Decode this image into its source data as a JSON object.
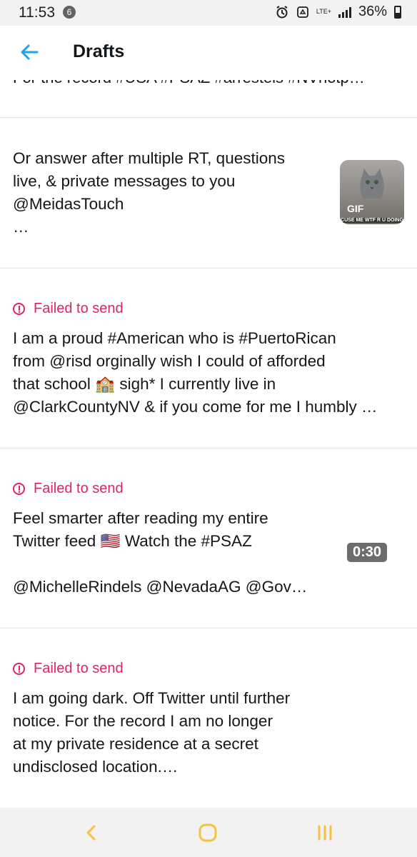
{
  "status_bar": {
    "time": "11:53",
    "notification_count": "6",
    "network": "LTE+",
    "battery": "36%"
  },
  "app_bar": {
    "title": "Drafts"
  },
  "drafts": [
    {
      "text": "For the record #USA #PSAZ #arrestels #NVhotp…"
    },
    {
      "text": "Or answer after multiple RT, questions\nlive, & private messages to you\n@MeidasTouch\n…",
      "media": {
        "type": "gif",
        "label": "GIF",
        "caption": "CUSE ME WTF R U DOING"
      }
    },
    {
      "status": "Failed to send",
      "text": "I am a proud #American who is #PuertoRican\nfrom @risd orginally wish I could of afforded\nthat school 🏫 sigh* I currently live in\n@ClarkCountyNV & if you come for me I humbly …"
    },
    {
      "status": "Failed to send",
      "text": "Feel smarter after reading my entire\nTwitter feed 🇺🇸 Watch the #PSAZ\n\n@MichelleRindels @NevadaAG @Gov…",
      "media": {
        "type": "video",
        "duration": "0:30"
      }
    },
    {
      "status": "Failed to send",
      "text": "I am going dark. Off Twitter until further\nnotice. For the record I am no longer\nat my private residence at a secret\nundisclosed location.…"
    }
  ],
  "colors": {
    "accent": "#1da1f2",
    "error": "#e0245e",
    "nav_icons": "#f5c242"
  }
}
